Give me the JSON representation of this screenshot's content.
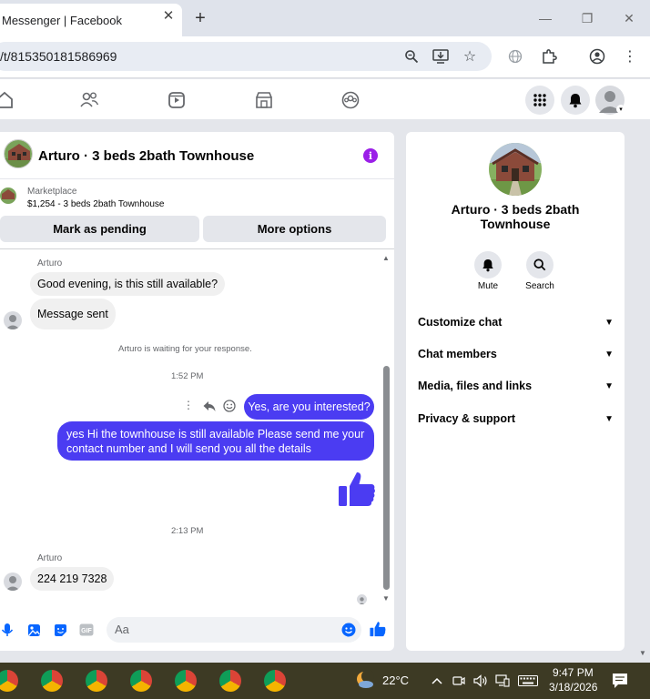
{
  "browser": {
    "tab_title": "Messenger | Facebook",
    "url": "/t/815350181586969",
    "accent": "#4b3cf2"
  },
  "chat": {
    "title": "Arturo · 3 beds 2bath Townhouse",
    "marketplace_label": "Marketplace",
    "listing": "$1,254 - 3 beds 2bath Townhouse",
    "btn_pending": "Mark as pending",
    "btn_more": "More options",
    "messages": {
      "sender_1": "Arturo",
      "in_1": "Good evening, is this still available?",
      "in_2": "Message sent",
      "waiting": "Arturo is waiting for your response.",
      "time_1": "1:52 PM",
      "out_1": "Yes, are you interested?",
      "out_2": "yes Hi the townhouse is still available Please send me your contact number and I will send you all the details",
      "time_2": "2:13 PM",
      "sender_2": "Arturo",
      "in_3": "224 219 7328"
    },
    "composer_placeholder": "Aa"
  },
  "info_panel": {
    "name": "Arturo · 3 beds 2bath Townhouse",
    "mute_label": "Mute",
    "search_label": "Search",
    "sections": [
      "Customize chat",
      "Chat members",
      "Media, files and links",
      "Privacy & support"
    ]
  },
  "taskbar": {
    "temperature": "22°C",
    "time": "9:47 PM",
    "date": "3/18/2026"
  }
}
